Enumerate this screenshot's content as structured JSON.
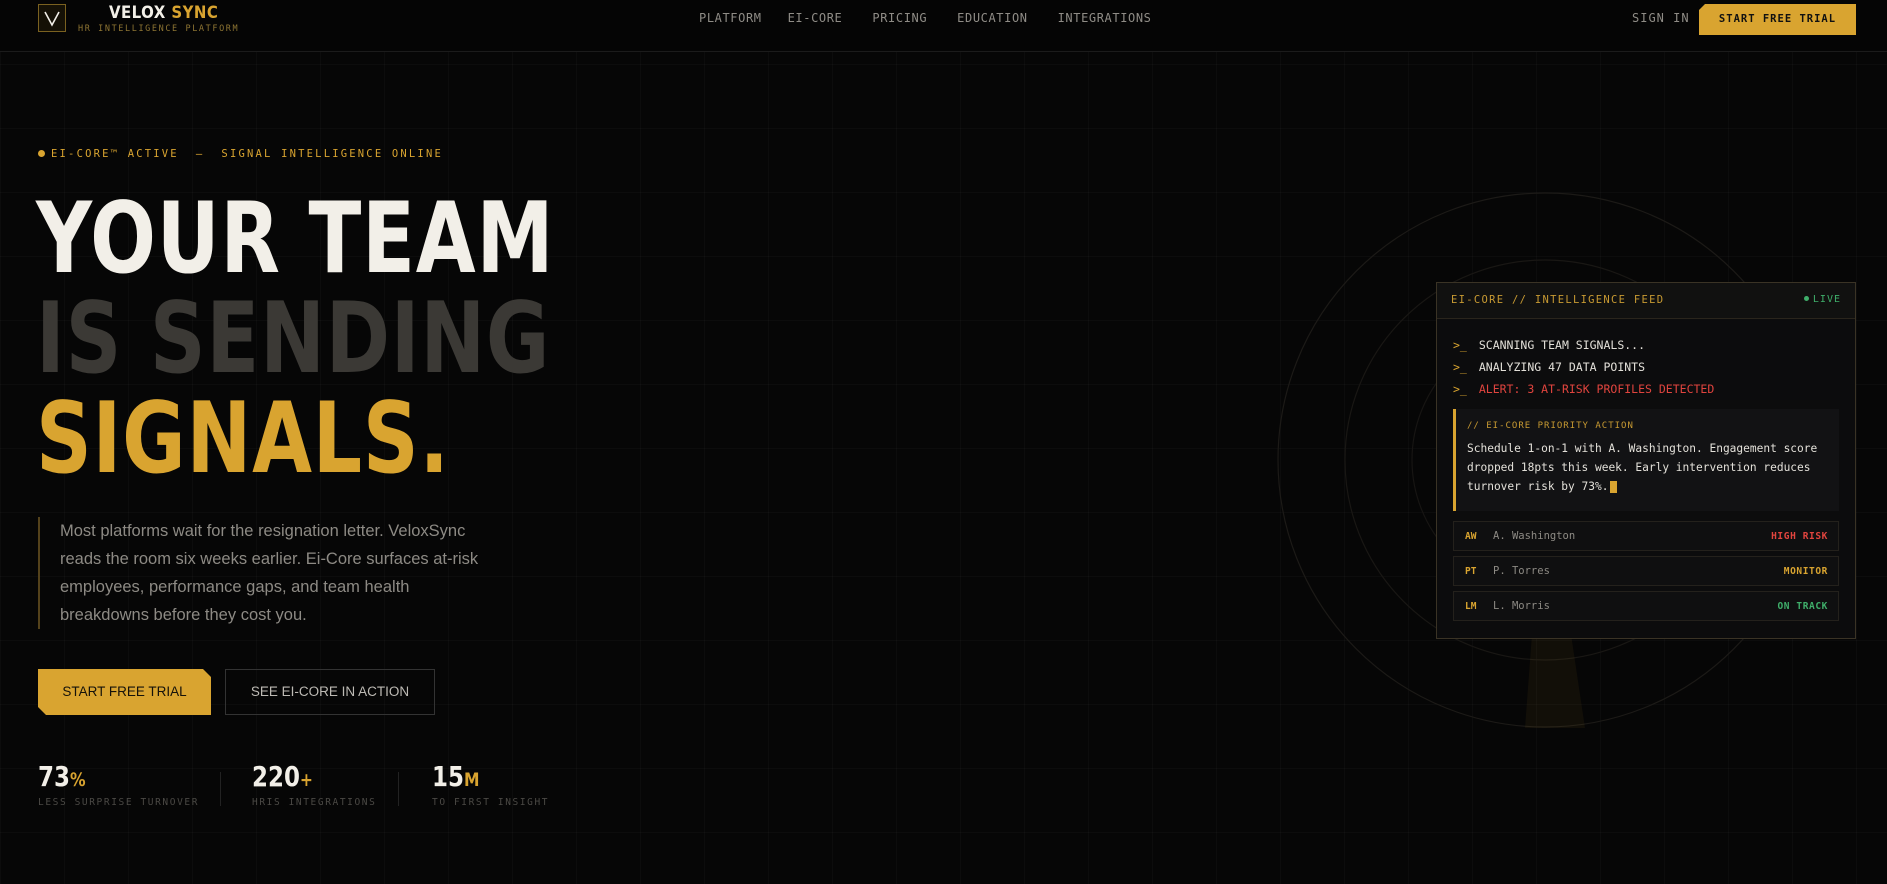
{
  "nav": {
    "brand_name": "VELOX",
    "brand_accent": "SYNC",
    "brand_sub": "HR INTELLIGENCE PLATFORM",
    "links": [
      "PLATFORM",
      "EI-CORE",
      "PRICING",
      "EDUCATION",
      "INTEGRATIONS"
    ],
    "sign_in": "SIGN IN",
    "cta": "START FREE TRIAL"
  },
  "hero": {
    "kicker": "EI-CORE™ ACTIVE  —  SIGNAL INTELLIGENCE ONLINE",
    "headline": [
      "YOUR TEAM",
      "IS SENDING",
      "SIGNALS."
    ],
    "lede": "Most platforms wait for the resignation letter. VeloxSync reads the room six weeks earlier. Ei-Core surfaces at-risk employees, performance gaps, and team health breakdowns before they cost you.",
    "primary_button": "START FREE TRIAL",
    "secondary_button": "SEE EI-CORE IN ACTION",
    "stats": [
      {
        "value": "73",
        "unit": "%",
        "label": "LESS SURPRISE TURNOVER"
      },
      {
        "value": "220",
        "unit": "+",
        "label": "HRIS INTEGRATIONS"
      },
      {
        "value": "15",
        "unit": "M",
        "label": "TO FIRST INSIGHT"
      }
    ]
  },
  "feed": {
    "title": "EI-CORE // INTELLIGENCE FEED",
    "live": "LIVE",
    "prompt": ">_",
    "logs": [
      {
        "text": "SCANNING TEAM SIGNALS..."
      },
      {
        "text": "ANALYZING 47 DATA POINTS"
      },
      {
        "text": "ALERT: 3 AT-RISK PROFILES DETECTED"
      }
    ],
    "priority_label": "// EI-CORE PRIORITY ACTION",
    "priority_text": "Schedule 1-on-1 with A. Washington. Engagement score dropped 18pts this week. Early intervention reduces turnover risk by 73%.",
    "people": [
      {
        "initials": "AW",
        "name": "A. Washington",
        "status": "HIGH RISK"
      },
      {
        "initials": "PT",
        "name": "P. Torres",
        "status": "MONITOR"
      },
      {
        "initials": "LM",
        "name": "L. Morris",
        "status": "ON TRACK"
      }
    ]
  },
  "colors": {
    "accent": "#d9a430",
    "background": "#060606",
    "risk_high": "#e0443e",
    "risk_ok": "#3fae6a"
  }
}
